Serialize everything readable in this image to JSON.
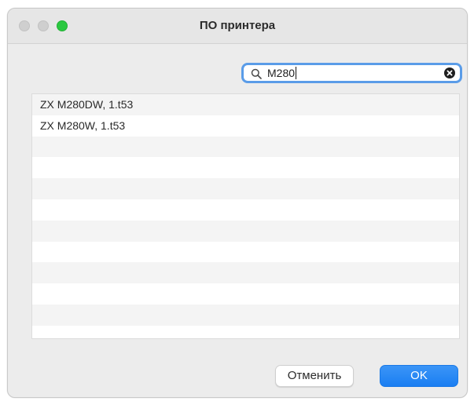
{
  "window": {
    "title": "ПО принтера"
  },
  "search": {
    "value": "M280"
  },
  "list": {
    "items": [
      "ZX M280DW, 1.t53",
      "ZX M280W, 1.t53",
      "",
      "",
      "",
      "",
      "",
      "",
      "",
      "",
      "",
      ""
    ]
  },
  "buttons": {
    "cancel_label": "Отменить",
    "ok_label": "OK"
  },
  "colors": {
    "accent": "#1a7ef2",
    "focus_ring": "#5a9ce8",
    "zoom_button": "#2ac840"
  }
}
